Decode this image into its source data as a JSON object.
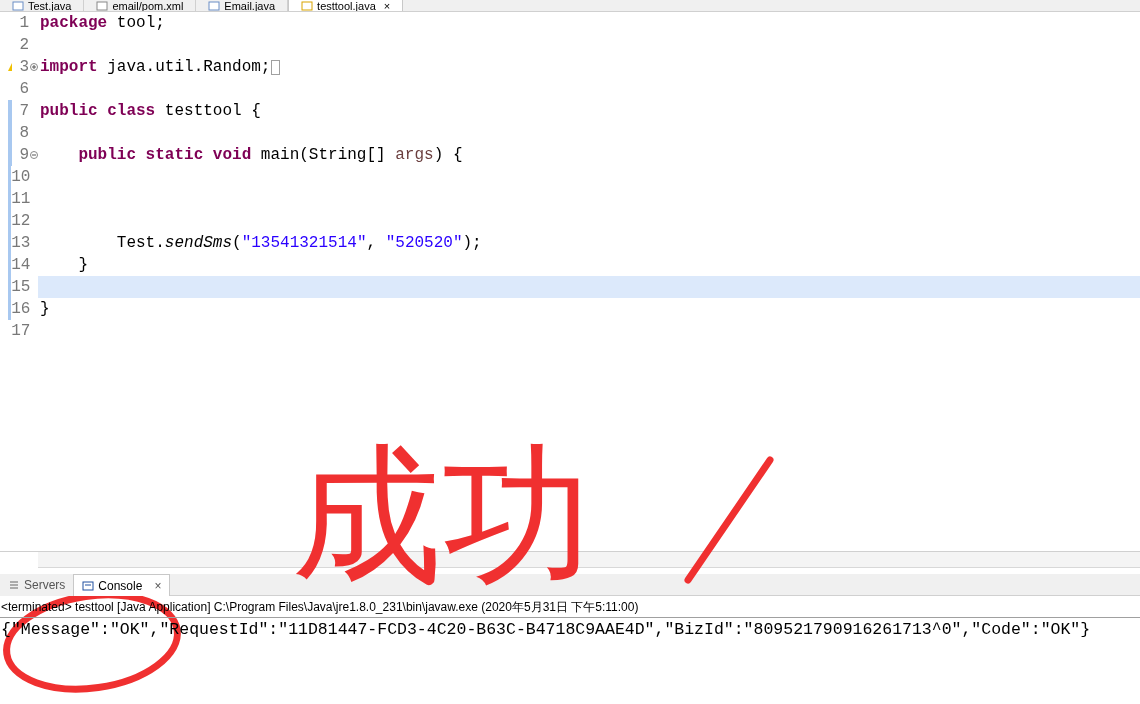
{
  "editor_tabs": [
    {
      "label": "Test.java",
      "selected": false
    },
    {
      "label": "email/pom.xml",
      "selected": false
    },
    {
      "label": "Email.java",
      "selected": false
    },
    {
      "label": "testtool.java",
      "selected": true,
      "close": "×"
    }
  ],
  "code_lines": [
    {
      "number": "1",
      "changed": false,
      "current": false,
      "tokens": [
        {
          "kind": "keyword",
          "text": "package"
        },
        {
          "kind": "plain",
          "text": " tool;"
        }
      ]
    },
    {
      "number": "2",
      "changed": false,
      "current": false
    },
    {
      "number": "3",
      "changed": false,
      "current": false,
      "warning": true,
      "folded": true,
      "tokens": [
        {
          "kind": "keyword",
          "text": "import"
        },
        {
          "kind": "plain",
          "text": " java.util.Random;"
        }
      ]
    },
    {
      "number": "6",
      "changed": false,
      "current": false
    },
    {
      "number": "7",
      "changed": true,
      "current": false,
      "tokens": [
        {
          "kind": "keyword",
          "text": "public class"
        },
        {
          "kind": "plain",
          "text": " testtool {"
        }
      ]
    },
    {
      "number": "8",
      "changed": true,
      "current": false
    },
    {
      "number": "9",
      "changed": true,
      "current": false,
      "folded": false,
      "tokens": [
        {
          "kind": "keyword",
          "text": "    public static void"
        },
        {
          "kind": "plain",
          "text": " main(String[] "
        },
        {
          "kind": "param",
          "text": "args"
        },
        {
          "kind": "plain",
          "text": ") {"
        }
      ]
    },
    {
      "number": "10",
      "changed": true,
      "current": false
    },
    {
      "number": "11",
      "changed": true,
      "current": false
    },
    {
      "number": "12",
      "changed": true,
      "current": false
    },
    {
      "number": "13",
      "changed": true,
      "current": false,
      "tokens": [
        {
          "kind": "plain",
          "text": "        Test."
        },
        {
          "kind": "static-method",
          "text": "sendSms"
        },
        {
          "kind": "plain",
          "text": "("
        },
        {
          "kind": "string",
          "text": "\"13541321514\""
        },
        {
          "kind": "plain",
          "text": ", "
        },
        {
          "kind": "string",
          "text": "\"520520\""
        },
        {
          "kind": "plain",
          "text": ");"
        }
      ]
    },
    {
      "number": "14",
      "changed": true,
      "current": false,
      "tokens": [
        {
          "kind": "plain",
          "text": "    }"
        }
      ]
    },
    {
      "number": "15",
      "changed": true,
      "current": true
    },
    {
      "number": "16",
      "changed": true,
      "current": false,
      "tokens": [
        {
          "kind": "plain",
          "text": "}"
        }
      ]
    },
    {
      "number": "17",
      "changed": false,
      "current": false
    }
  ],
  "console_tabs": [
    {
      "label": "Servers",
      "selected": false
    },
    {
      "label": "Console",
      "selected": true,
      "close": "×"
    }
  ],
  "console": {
    "status": "<terminated> testtool [Java Application] C:\\Program Files\\Java\\jre1.8.0_231\\bin\\javaw.exe (2020年5月31日 下午5:11:00)",
    "output": "{\"Message\":\"OK\",\"RequestId\":\"11D81447-FCD3-4C20-B63C-B4718C9AAE4D\",\"BizId\":\"809521790916261713^0\",\"Code\":\"OK\"}"
  },
  "annotation": {
    "text": "成功"
  }
}
